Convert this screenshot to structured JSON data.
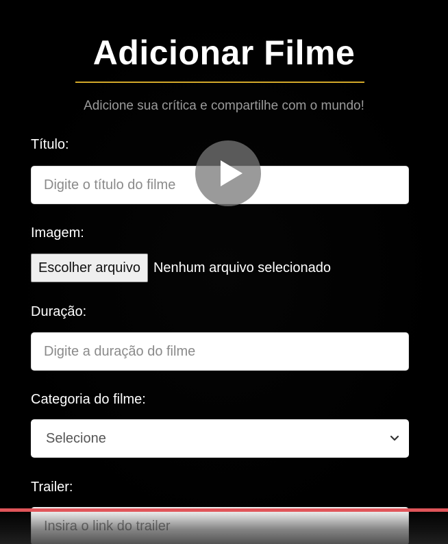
{
  "header": {
    "title": "Adicionar Filme",
    "subtitle": "Adicione sua crítica e compartilhe com o mundo!",
    "accent_color": "#d4a92a"
  },
  "form": {
    "title_label": "Título:",
    "title_placeholder": "Digite o título do filme",
    "image_label": "Imagem:",
    "file_button_label": "Escolher arquivo",
    "file_status": "Nenhum arquivo selecionado",
    "duration_label": "Duração:",
    "duration_placeholder": "Digite a duração do filme",
    "category_label": "Categoria do filme:",
    "category_selected": "Selecione",
    "trailer_label": "Trailer:",
    "trailer_placeholder": "Insira o link do trailer"
  },
  "video": {
    "play_icon": "play-icon",
    "progress_color": "#e0555a",
    "progress": 1.0
  }
}
